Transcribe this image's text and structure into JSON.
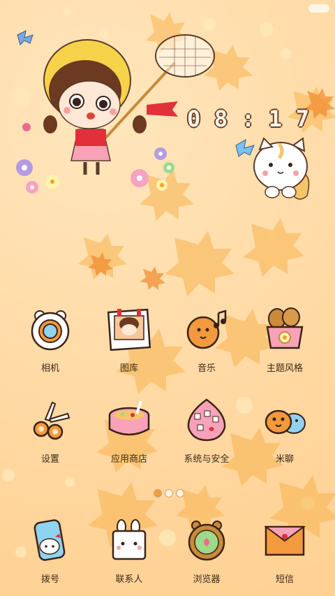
{
  "status": {
    "battery_indicator": "pill"
  },
  "clock": {
    "h1": "0",
    "h2": "8",
    "sep": ":",
    "m1": "1",
    "m2": "7"
  },
  "apps": {
    "row1": [
      {
        "label": "相机",
        "icon": "camera-icon"
      },
      {
        "label": "图库",
        "icon": "gallery-icon"
      },
      {
        "label": "音乐",
        "icon": "music-icon"
      },
      {
        "label": "主题风格",
        "icon": "theme-icon"
      }
    ],
    "row2": [
      {
        "label": "设置",
        "icon": "settings-icon"
      },
      {
        "label": "应用商店",
        "icon": "app-store-icon"
      },
      {
        "label": "系统与安全",
        "icon": "security-icon"
      },
      {
        "label": "米聊",
        "icon": "chat-icon"
      }
    ],
    "dock": [
      {
        "label": "拨号",
        "icon": "phone-icon"
      },
      {
        "label": "联系人",
        "icon": "contacts-icon"
      },
      {
        "label": "浏览器",
        "icon": "browser-icon"
      },
      {
        "label": "短信",
        "icon": "messages-icon"
      }
    ]
  },
  "pager": {
    "count": 3,
    "active": 0
  },
  "colors": {
    "background": "#ffd9a3",
    "leaf": "#f7a93a",
    "text": "#3a2a1a",
    "clock_outline": "#6b3e26"
  }
}
